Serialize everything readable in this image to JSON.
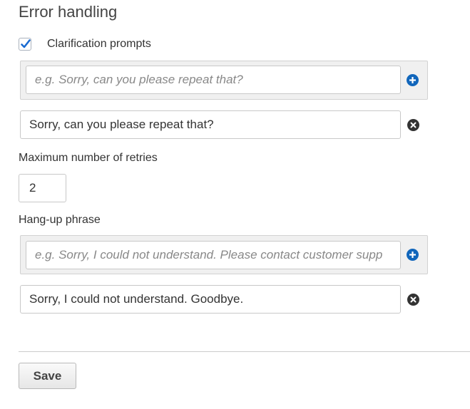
{
  "section": {
    "title": "Error handling"
  },
  "clarification": {
    "checkbox_checked": true,
    "label": "Clarification prompts",
    "input_placeholder": "e.g. Sorry, can you please repeat that?",
    "prompts": [
      "Sorry, can you please repeat that?"
    ],
    "add_icon": "plus-circle-icon",
    "remove_icon": "x-circle-icon"
  },
  "retries": {
    "label": "Maximum number of retries",
    "value": "2"
  },
  "hangup": {
    "label": "Hang-up phrase",
    "input_placeholder": "e.g. Sorry, I could not understand. Please contact customer supp",
    "phrases": [
      "Sorry, I could not understand. Goodbye."
    ],
    "add_icon": "plus-circle-icon",
    "remove_icon": "x-circle-icon"
  },
  "footer": {
    "save_label": "Save"
  },
  "colors": {
    "accent_blue": "#1166bb",
    "remove_dark": "#333333",
    "checkmark": "#1a6bd1"
  }
}
